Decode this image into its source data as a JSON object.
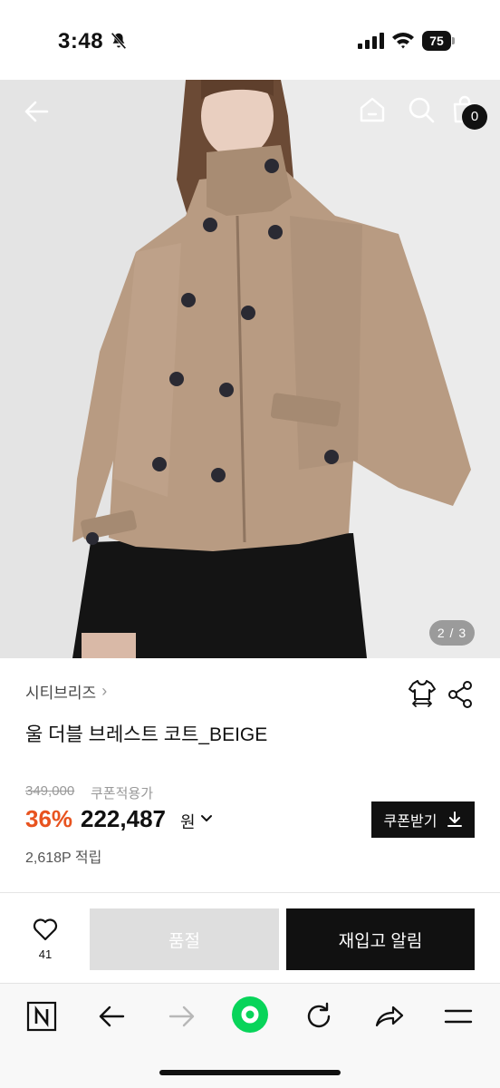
{
  "status": {
    "time": "3:48",
    "battery": "75",
    "icons": [
      "bell-slash-icon",
      "signal-icon",
      "wifi-icon",
      "battery-icon"
    ]
  },
  "hero": {
    "image_counter": "2 / 3",
    "bag_count": "0",
    "icons": [
      "back-arrow-icon",
      "home-icon",
      "search-icon",
      "shopping-bag-icon"
    ]
  },
  "product": {
    "brand": "시티브리즈",
    "brand_chevron": "›",
    "title": "울 더블 브레스트 코트_BEIGE",
    "original_price": "349,000",
    "coupon_note": "쿠폰적용가",
    "discount": "36%",
    "sale_price": "222,487",
    "currency": "원",
    "points": "2,618P 적립",
    "coupon_button": "쿠폰받기",
    "icons": [
      "size-guide-shirt-icon",
      "share-icon",
      "download-icon",
      "chevron-down-icon"
    ]
  },
  "actions": {
    "like_count": "41",
    "soldout_label": "품절",
    "restock_label": "재입고 알림",
    "icons": [
      "heart-icon"
    ]
  },
  "browser_toolbar": {
    "icons": [
      "naver-n-icon",
      "back-icon",
      "forward-icon",
      "green-home-icon",
      "reload-icon",
      "share-arrow-icon",
      "menu-icon"
    ]
  },
  "colors": {
    "discount": "#e8531f",
    "primary_button": "#111111",
    "disabled_button": "#dedede",
    "green_accent": "#08d45a"
  }
}
